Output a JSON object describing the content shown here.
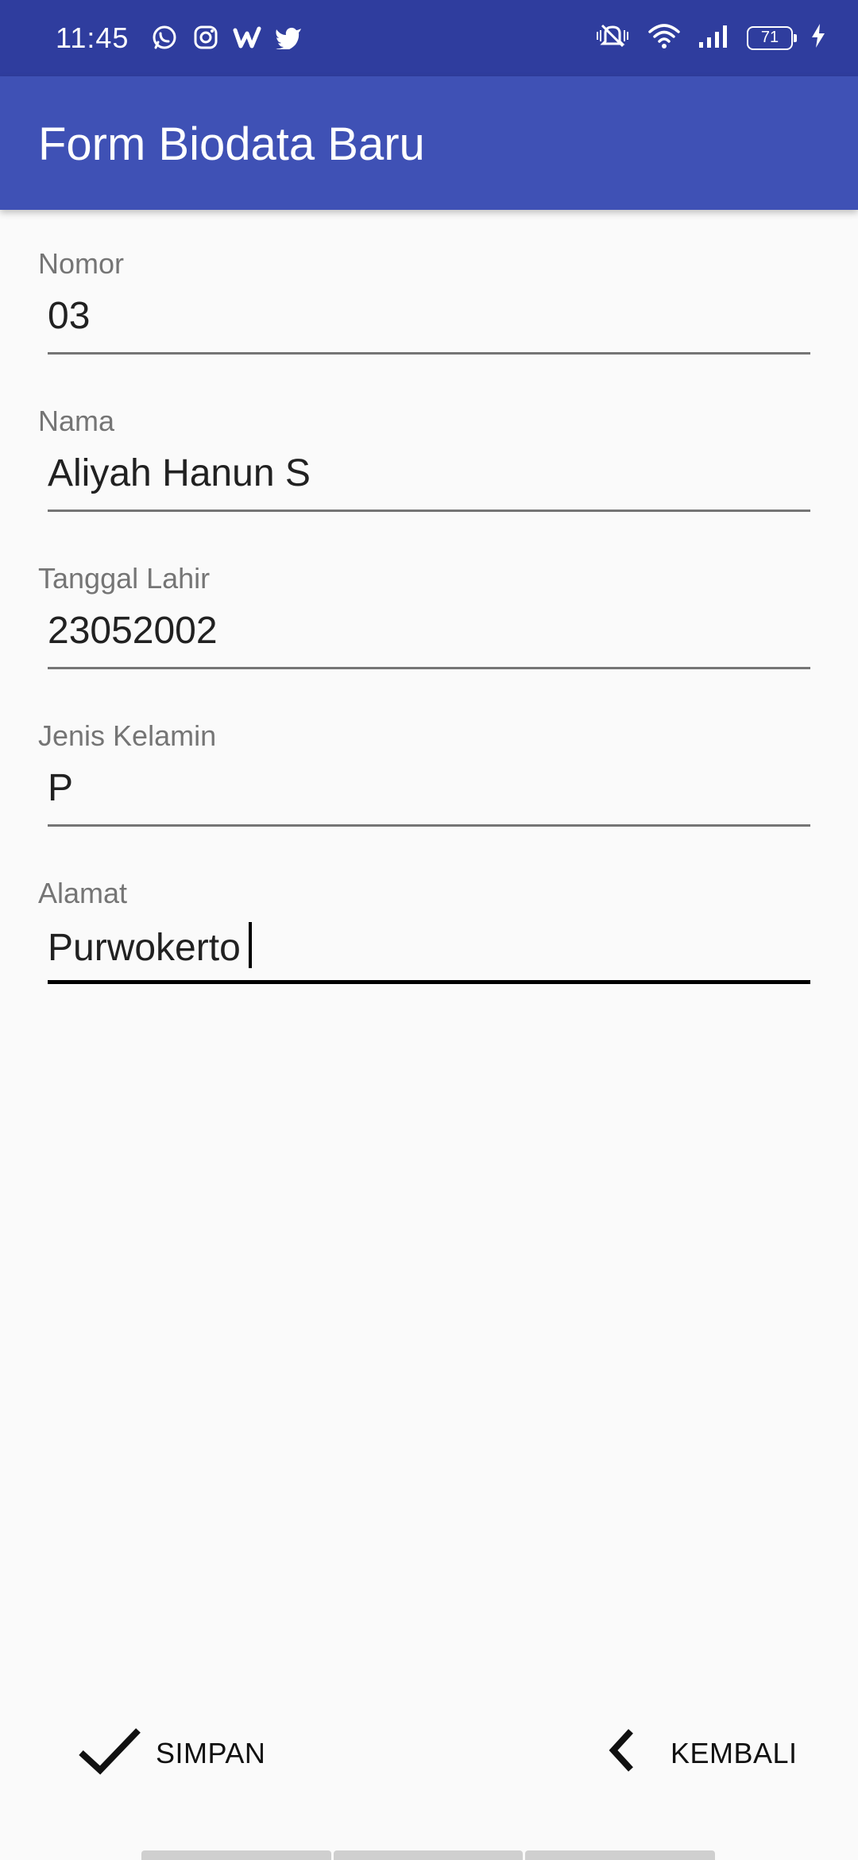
{
  "status_bar": {
    "time": "11:45",
    "battery": "71",
    "left_icons": [
      "whatsapp-icon",
      "instagram-icon",
      "wattpad-icon",
      "twitter-icon"
    ],
    "right_icons": [
      "vibrate-mute-icon",
      "wifi-icon",
      "signal-icon",
      "battery-icon",
      "charging-icon"
    ]
  },
  "app_bar": {
    "title": "Form Biodata Baru",
    "color": "#3f51b5",
    "status_color": "#2f3d9e"
  },
  "form": {
    "fields": [
      {
        "label": "Nomor",
        "value": "03"
      },
      {
        "label": "Nama",
        "value": "Aliyah Hanun S"
      },
      {
        "label": "Tanggal Lahir",
        "value": "23052002"
      },
      {
        "label": "Jenis Kelamin",
        "value": "P"
      },
      {
        "label": "Alamat",
        "value": "Purwokerto"
      }
    ]
  },
  "actions": {
    "save_label": "SIMPAN",
    "back_label": "KEMBALI"
  }
}
